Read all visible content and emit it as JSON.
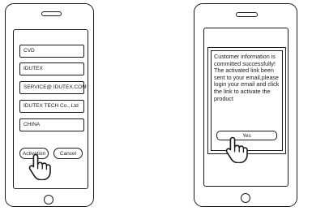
{
  "left_phone": {
    "form": {
      "fields": [
        {
          "value": "CVD"
        },
        {
          "value": "IDUTEX"
        },
        {
          "value": "SERVICE@ IDUTEX.COM"
        },
        {
          "value": "IDUTEX TECH Co., Ltd"
        },
        {
          "value": "CHINA"
        }
      ],
      "activation_label": "Activation",
      "cancel_label": "Cancel"
    },
    "icons": {
      "pointer": "hand-pointer-icon"
    }
  },
  "right_phone": {
    "dialog": {
      "message": "Customer information is committed successfully! The activated link been sent to your email,please login your email and click the link to activate the product",
      "yes_label": "Yes"
    },
    "icons": {
      "pointer": "hand-pointer-icon"
    }
  }
}
